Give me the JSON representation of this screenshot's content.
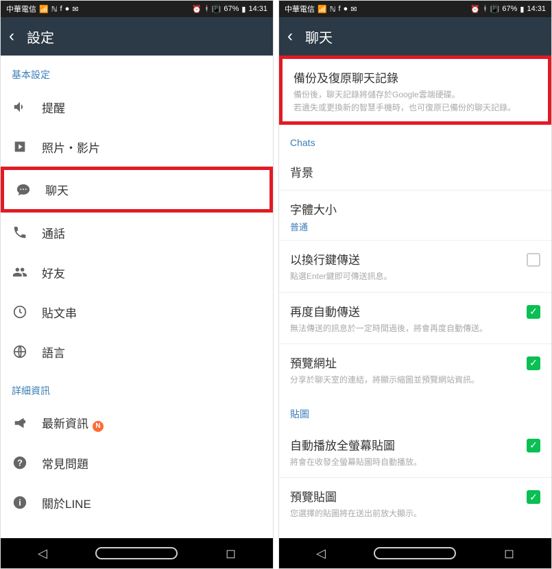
{
  "statusBar": {
    "carrier": "中華電信",
    "battery": "67%",
    "time": "14:31"
  },
  "left": {
    "headerTitle": "設定",
    "sections": {
      "basic": {
        "header": "基本設定",
        "items": [
          {
            "label": "提醒",
            "icon": "volume"
          },
          {
            "label": "照片・影片",
            "icon": "media"
          },
          {
            "label": "聊天",
            "icon": "chat",
            "highlighted": true
          },
          {
            "label": "通話",
            "icon": "phone"
          },
          {
            "label": "好友",
            "icon": "friends"
          },
          {
            "label": "貼文串",
            "icon": "timeline"
          },
          {
            "label": "語言",
            "icon": "globe"
          }
        ]
      },
      "details": {
        "header": "詳細資訊",
        "items": [
          {
            "label": "最新資訊",
            "icon": "announce",
            "badge": "N"
          },
          {
            "label": "常見問題",
            "icon": "help"
          },
          {
            "label": "關於LINE",
            "icon": "info"
          }
        ]
      }
    }
  },
  "right": {
    "headerTitle": "聊天",
    "backup": {
      "title": "備份及復原聊天記錄",
      "desc1": "備份後，聊天記錄將儲存於Google雲端硬碟。",
      "desc2": "若遺失或更換新的智慧手機時，也可復原已備份的聊天記錄。"
    },
    "chatsHeader": "Chats",
    "background": {
      "label": "背景"
    },
    "fontSize": {
      "label": "字體大小",
      "value": "普通"
    },
    "enterSend": {
      "label": "以換行鍵傳送",
      "desc": "點選Enter鍵即可傳送訊息。",
      "checked": false
    },
    "resend": {
      "label": "再度自動傳送",
      "desc": "無法傳送的訊息於一定時間過後，將會再度自動傳送。",
      "checked": true
    },
    "previewUrl": {
      "label": "預覽網址",
      "desc": "分享於聊天室的連結，將顯示縮圖並預覽網站資訊。",
      "checked": true
    },
    "stickerHeader": "貼圖",
    "autoplaySticker": {
      "label": "自動播放全螢幕貼圖",
      "desc": "將會在收發全螢幕貼圖時自動播放。",
      "checked": true
    },
    "previewSticker": {
      "label": "預覽貼圖",
      "desc": "您選擇的貼圖將在送出前放大顯示。",
      "checked": true
    }
  }
}
